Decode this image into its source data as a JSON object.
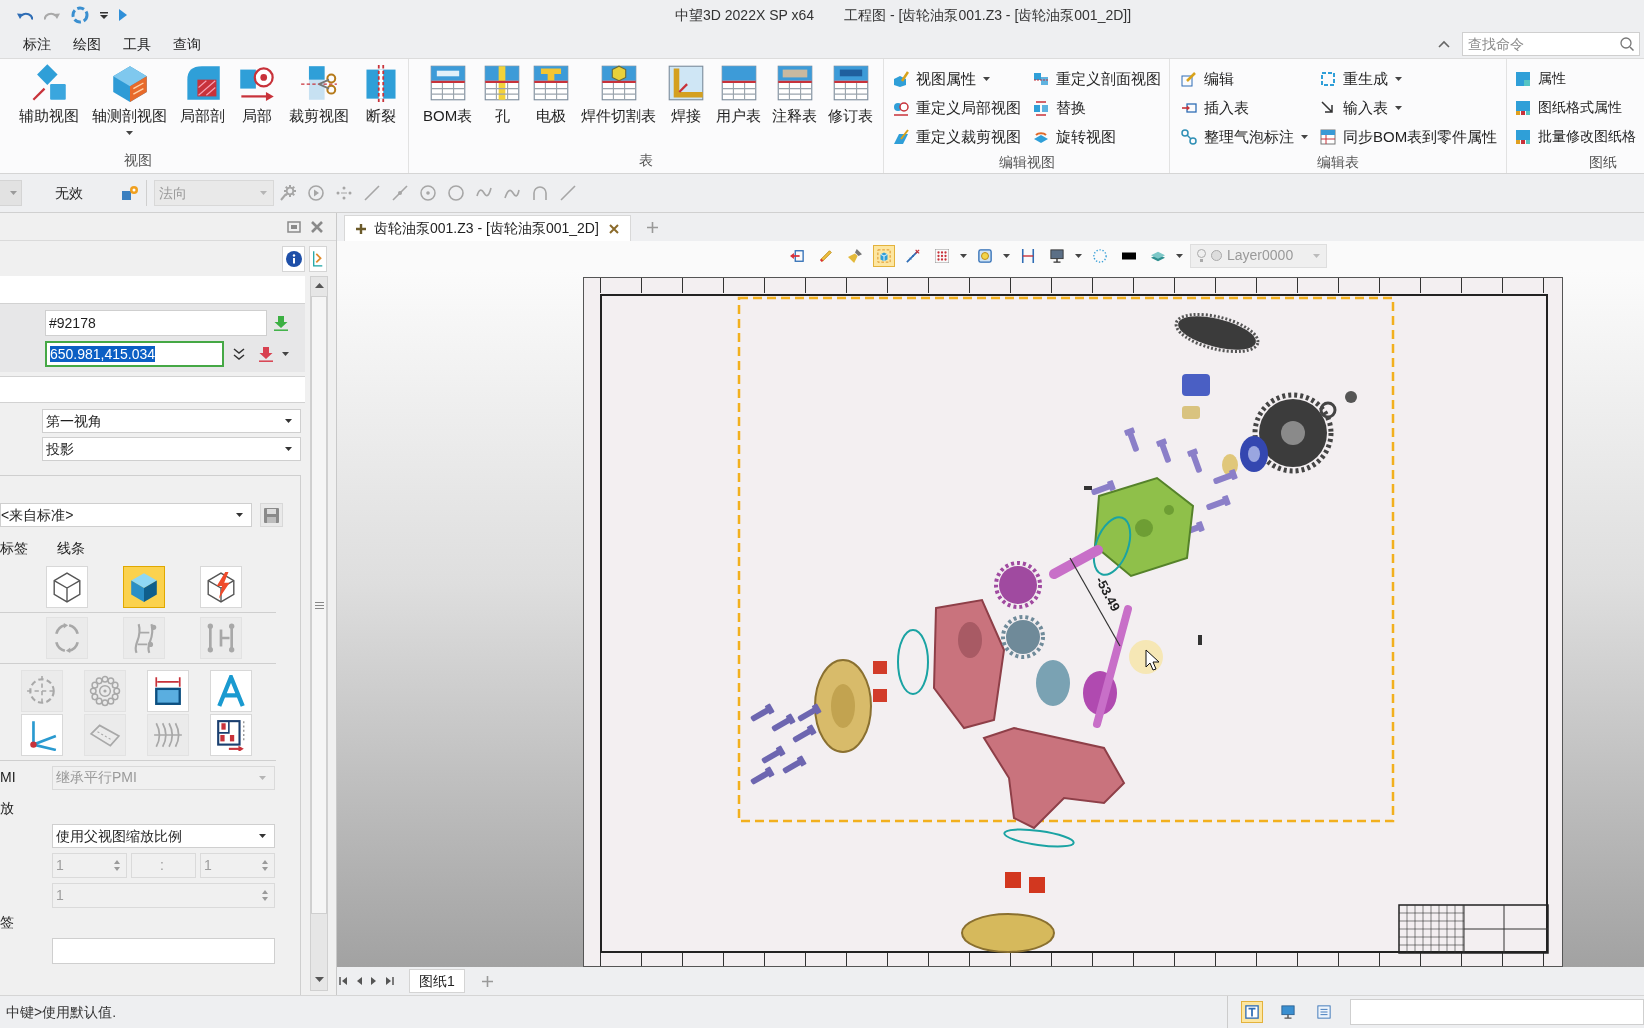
{
  "title_bar": {
    "app_name": "中望3D 2022X SP x64",
    "document": "工程图 - [齿轮油泵001.Z3 - [齿轮油泵001_2D]]"
  },
  "menu_tabs": [
    {
      "label": "标注",
      "selected": false
    },
    {
      "label": "绘图",
      "selected": false
    },
    {
      "label": "工具",
      "selected": false
    },
    {
      "label": "查询",
      "selected": false
    }
  ],
  "search": {
    "placeholder": "查找命令"
  },
  "ribbon_groups": [
    {
      "title": "视图",
      "kind": "large",
      "buttons": [
        {
          "label": "辅助视图",
          "has_menu": false
        },
        {
          "label": "轴测剖视图",
          "has_menu": true
        },
        {
          "label": "局部剖",
          "has_menu": false
        },
        {
          "label": "局部",
          "has_menu": false
        },
        {
          "label": "裁剪视图",
          "has_menu": false
        },
        {
          "label": "断裂",
          "has_menu": false
        }
      ]
    },
    {
      "title": "表",
      "kind": "large",
      "buttons": [
        {
          "label": "BOM表",
          "has_menu": false
        },
        {
          "label": "孔",
          "has_menu": false
        },
        {
          "label": "电极",
          "has_menu": false
        },
        {
          "label": "焊件切割表",
          "has_menu": false
        },
        {
          "label": "焊接",
          "has_menu": false
        },
        {
          "label": "用户表",
          "has_menu": false
        },
        {
          "label": "注释表",
          "has_menu": false
        },
        {
          "label": "修订表",
          "has_menu": false
        }
      ]
    },
    {
      "title": "编辑视图",
      "kind": "small",
      "buttons": [
        {
          "label": "视图属性",
          "has_menu": true
        },
        {
          "label": "重定义局部视图",
          "has_menu": false
        },
        {
          "label": "重定义裁剪视图",
          "has_menu": false
        },
        {
          "label": "重定义剖面视图",
          "has_menu": false
        },
        {
          "label": "替换",
          "has_menu": false
        },
        {
          "label": "旋转视图",
          "has_menu": false
        }
      ]
    },
    {
      "title": "编辑表",
      "kind": "small",
      "buttons": [
        {
          "label": "编辑",
          "has_menu": false
        },
        {
          "label": "插入表",
          "has_menu": false
        },
        {
          "label": "整理气泡标注",
          "has_menu": true
        },
        {
          "label": "重生成",
          "has_menu": true
        },
        {
          "label": "输入表",
          "has_menu": true
        },
        {
          "label": "同步BOM表到零件属性",
          "has_menu": false
        }
      ]
    },
    {
      "title": "图纸",
      "kind": "small",
      "buttons": [
        {
          "label": "属性",
          "has_menu": false
        },
        {
          "label": "图纸格式属性",
          "has_menu": false
        },
        {
          "label": "批量修改图纸格",
          "has_menu": false
        }
      ]
    }
  ],
  "filter_bar": {
    "mode": "无效",
    "direction": {
      "value": "法向",
      "disabled": true
    }
  },
  "panel": {
    "entity": "#92178",
    "point": {
      "value": "650.981,415.034",
      "focused": true
    },
    "view_angle": "第一视角",
    "projection": "投影",
    "style": "<来自标准>",
    "tabs": [
      {
        "label": "标签",
        "selected": false
      },
      {
        "label": "线条",
        "selected": false
      }
    ],
    "tool_rows": [
      [
        {
          "selected": false,
          "disabled": false
        },
        {
          "selected": true,
          "disabled": false
        },
        {
          "selected": false,
          "disabled": false
        }
      ],
      [
        {
          "selected": false,
          "disabled": true
        },
        {
          "selected": false,
          "disabled": true
        },
        {
          "selected": false,
          "disabled": true
        }
      ],
      [
        {
          "selected": false,
          "disabled": true
        },
        {
          "selected": false,
          "disabled": true
        },
        {
          "selected": false,
          "disabled": false
        },
        {
          "selected": false,
          "disabled": false
        }
      ],
      [
        {
          "selected": false,
          "disabled": false
        },
        {
          "selected": false,
          "disabled": true
        },
        {
          "selected": false,
          "disabled": true
        },
        {
          "selected": false,
          "disabled": false
        }
      ]
    ],
    "pmi": {
      "label": "MI",
      "value": "继承平行PMI",
      "disabled": true
    },
    "scale": {
      "label": "放",
      "value": "使用父视图缩放比例",
      "numerator": "1",
      "separator": ":",
      "denominator": "1",
      "factor": "1",
      "disabled": true
    },
    "tag": {
      "label": "签"
    }
  },
  "document_tab": {
    "label": "齿轮油泵001.Z3 - [齿轮油泵001_2D]",
    "selected": true
  },
  "drawing_toolbar": {
    "tools": [
      {
        "selected": false,
        "has_menu": false
      },
      {
        "selected": false,
        "has_menu": false
      },
      {
        "selected": false,
        "has_menu": false
      },
      {
        "selected": true,
        "has_menu": false
      },
      {
        "selected": false,
        "has_menu": false
      },
      {
        "selected": false,
        "has_menu": true
      },
      {
        "selected": false,
        "has_menu": true
      },
      {
        "selected": false,
        "has_menu": false
      },
      {
        "selected": false,
        "has_menu": true
      },
      {
        "selected": false,
        "has_menu": false
      },
      {
        "selected": false,
        "has_menu": false
      },
      {
        "selected": false,
        "has_menu": true
      }
    ],
    "layer": "Layer0000"
  },
  "drawing": {
    "dimension": "-53.49"
  },
  "sheet_tabs": [
    {
      "label": "图纸1",
      "selected": true
    }
  ],
  "status_bar": {
    "message": "中键>使用默认值.",
    "view_modes": [
      {
        "selected": true
      },
      {
        "selected": false
      },
      {
        "selected": false
      }
    ]
  }
}
